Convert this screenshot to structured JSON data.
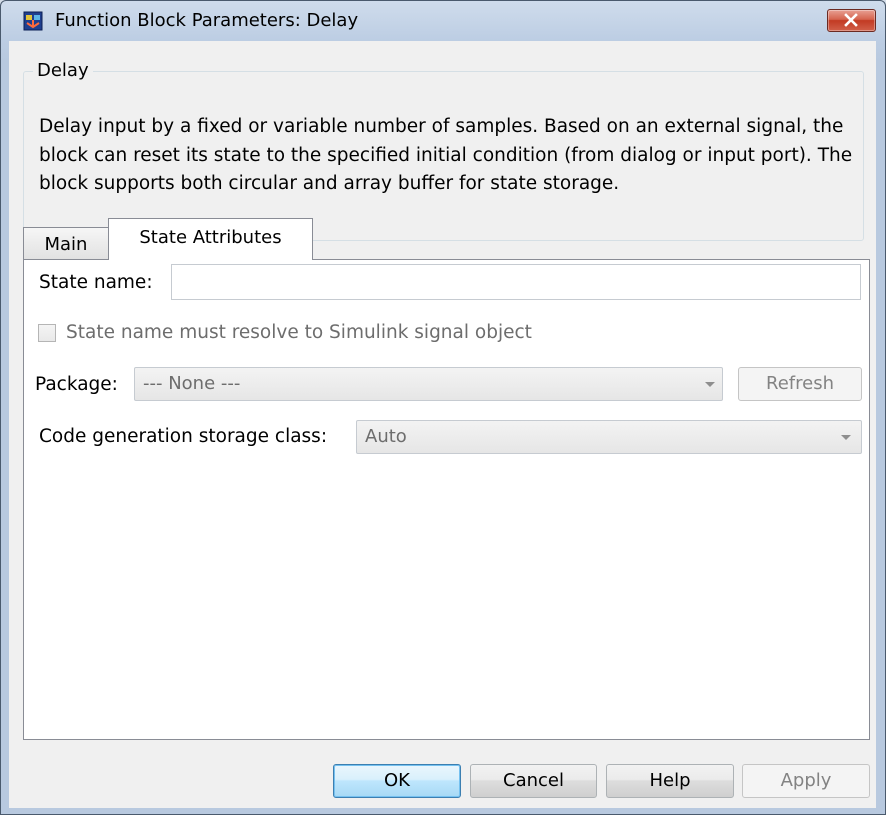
{
  "window": {
    "title": "Function Block Parameters: Delay",
    "icon": "simulink-block-icon",
    "close_icon": "close-icon"
  },
  "group": {
    "legend": "Delay",
    "description": "Delay input by a fixed or variable number of samples. Based on an external signal, the block can reset its state to the specified initial condition (from dialog or input port). The block supports both circular and array buffer for state storage."
  },
  "tabs": [
    {
      "label": "Main",
      "selected": false
    },
    {
      "label": "State Attributes",
      "selected": true
    }
  ],
  "state_attributes": {
    "state_name_label": "State name:",
    "state_name_value": "",
    "resolve_checkbox_label": "State name must resolve to Simulink signal object",
    "resolve_checked": false,
    "package_label": "Package:",
    "package_value": "--- None ---",
    "refresh_label": "Refresh",
    "storage_class_label": "Code generation storage class:",
    "storage_class_value": "Auto"
  },
  "buttons": {
    "ok": "OK",
    "cancel": "Cancel",
    "help": "Help",
    "apply": "Apply"
  }
}
